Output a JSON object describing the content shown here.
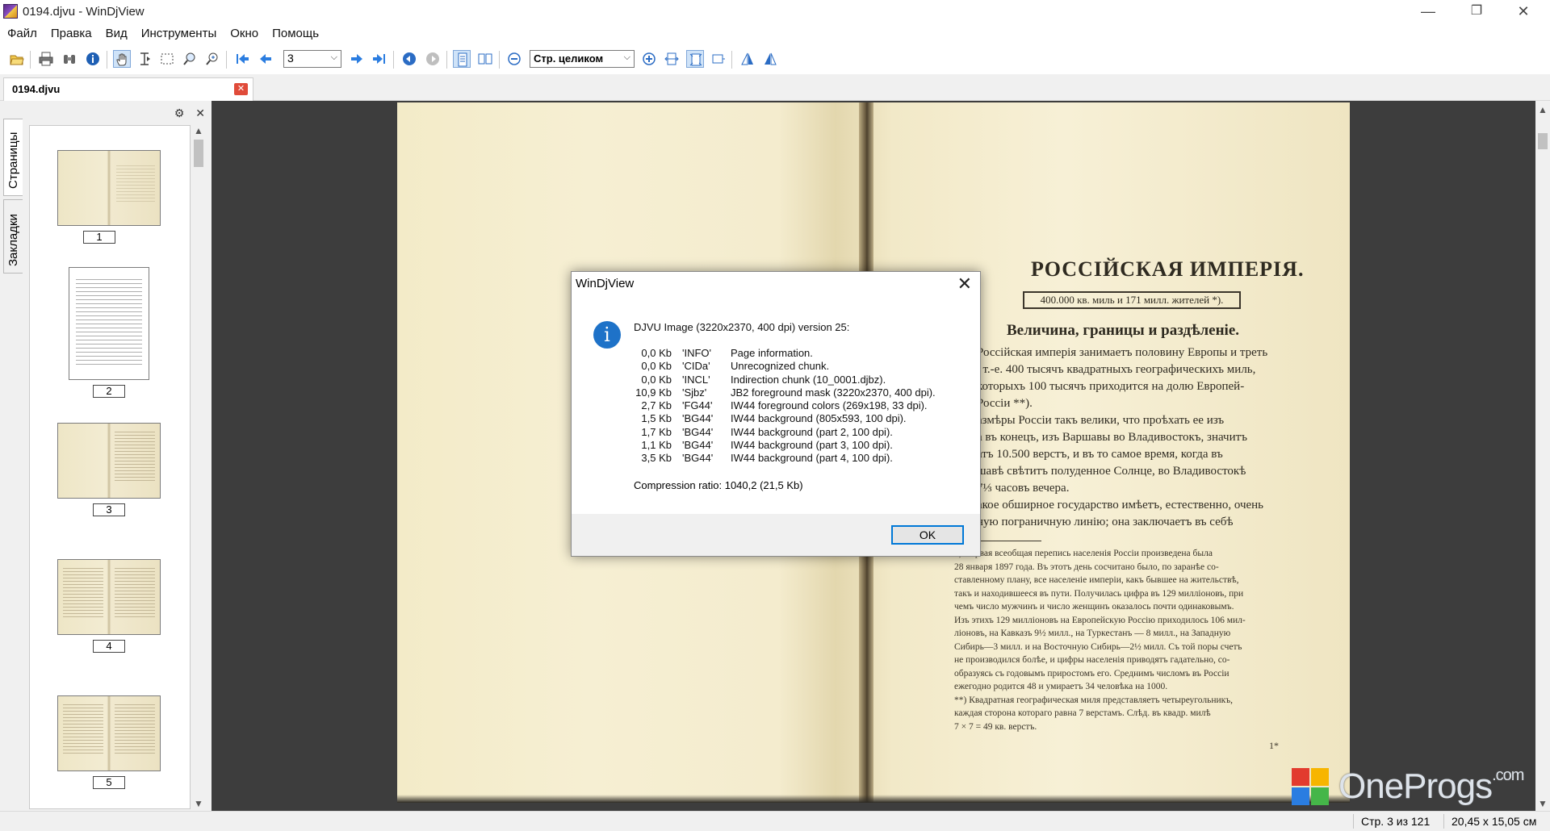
{
  "window": {
    "title": "0194.djvu - WinDjView",
    "controls": {
      "minimize": "—",
      "restore": "❐",
      "close": "✕"
    }
  },
  "menu": [
    "Файл",
    "Правка",
    "Вид",
    "Инструменты",
    "Окно",
    "Помощь"
  ],
  "toolbar": {
    "page_value": "3",
    "zoom_value": "Стр. целиком",
    "icons": [
      "open-icon",
      "print-icon",
      "find-icon",
      "info-icon",
      "hand-tool-icon",
      "text-select-icon",
      "rect-select-icon",
      "zoom-rect-icon",
      "magnify-icon",
      "first-page-icon",
      "prev-page-icon",
      "next-page-icon",
      "last-page-icon",
      "back-icon",
      "forward-icon",
      "single-page-icon",
      "facing-pages-icon",
      "zoom-out-icon",
      "zoom-in-icon",
      "fit-width-icon",
      "fit-page-icon",
      "actual-size-icon",
      "rotate-left-icon",
      "rotate-right-icon"
    ]
  },
  "tab": {
    "label": "0194.djvu",
    "close": "✕"
  },
  "sidebar": {
    "tabs": [
      "Страницы",
      "Закладки"
    ],
    "settings": "⚙",
    "close": "✕",
    "thumbnails": [
      {
        "label": "1"
      },
      {
        "label": "2"
      },
      {
        "label": "3"
      },
      {
        "label": "4"
      },
      {
        "label": "5"
      }
    ]
  },
  "page_content": {
    "title": "РОССІЙСКАЯ ИМПЕРІЯ.",
    "box": "400.000 кв. миль и 171 милл. жителей *).",
    "subtitle": "Величина, границы и раздѣленіе.",
    "body": "Россійская имперія занимаетъ половину Европы и треть\n, т.-е. 400 тысячъ квадратныхъ географическихъ миль,\nкоторыхъ 100 тысячъ приходится на долю Европей-\nРоссіи **).\nазмѣры Россіи такъ велики, что проѣхать ее изъ\nа въ конецъ, изъ Варшавы во Владивостокъ, значитъ\nатъ 10.500 верстъ, и въ то самое время, когда въ\nшавѣ свѣтитъ полуденное Солнце, во Владивостокѣ\n7⅓ часовъ вечера.\nакое обширное государство имѣетъ, естественно, очень\nную пограничную линію; она заключаетъ въ себѣ",
    "footnote": "*) Первая всеобщая перепись населенія Россіи произведена была\n28 января 1897 года. Въ этотъ день сосчитано было, по заранѣе со-\nставленному плану, все населеніе имперіи, какъ бывшее на жительствѣ,\nтакъ и находившееся въ пути. Получилась цифра въ 129 милліоновъ, при\nчемъ число мужчинъ и число женщинъ оказалось почти одинаковымъ.\nИзъ этихъ 129 милліоновъ на Европейскую Россію приходилось 106 мил-\nліоновъ, на Кавказъ 9½ милл., на Туркестанъ — 8 милл., на Западную\nСибирь—3 милл. и на Восточную Сибирь—2½ милл. Съ той поры счетъ\nне производился болѣе, и цифры населенія приводятъ гадательно, со-\nобразуясь съ годовымъ приростомъ его. Среднимъ числомъ въ Россіи\nежегодно родится 48 и умираетъ 34 человѣка на 1000.\n**) Квадратная географическая миля представляетъ четыреугольникъ,\nкаждая сторона котораго равна 7 верстамъ. Слѣд. въ квадр. милѣ\n7 × 7 = 49 кв. верстъ.",
    "page_number": "1*"
  },
  "dialog": {
    "title": "WinDjView",
    "close": "✕",
    "icon": "i",
    "message": "DJVU Image (3220x2370, 400 dpi) version 25:",
    "chunks": [
      {
        "size": "0,0 Kb",
        "id": "'INFO'",
        "desc": "Page information."
      },
      {
        "size": "0,0 Kb",
        "id": "'CIDa'",
        "desc": "Unrecognized chunk."
      },
      {
        "size": "0,0 Kb",
        "id": "'INCL'",
        "desc": "Indirection chunk (10_0001.djbz)."
      },
      {
        "size": "10,9 Kb",
        "id": "'Sjbz'",
        "desc": "JB2 foreground mask (3220x2370, 400 dpi)."
      },
      {
        "size": "2,7 Kb",
        "id": "'FG44'",
        "desc": "IW44 foreground colors (269x198, 33 dpi)."
      },
      {
        "size": "1,5 Kb",
        "id": "'BG44'",
        "desc": "IW44 background (805x593, 100 dpi)."
      },
      {
        "size": "1,7 Kb",
        "id": "'BG44'",
        "desc": "IW44 background (part 2, 100 dpi)."
      },
      {
        "size": "1,1 Kb",
        "id": "'BG44'",
        "desc": "IW44 background (part 3, 100 dpi)."
      },
      {
        "size": "3,5 Kb",
        "id": "'BG44'",
        "desc": "IW44 background (part 4, 100 dpi)."
      }
    ],
    "ratio": "Compression ratio: 1040,2 (21,5 Kb)",
    "ok": "OK"
  },
  "watermark": {
    "text": "OneProgs",
    "suffix": ".com"
  },
  "status": {
    "page": "Стр. 3 из 121",
    "size": "20,45 x 15,05 см"
  }
}
